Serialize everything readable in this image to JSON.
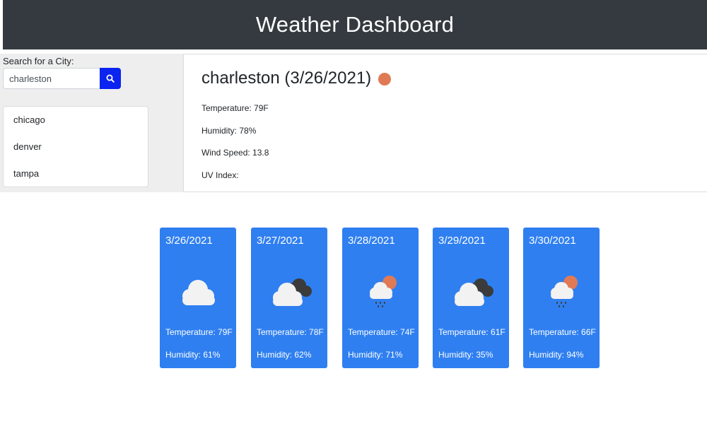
{
  "header": {
    "title": "Weather Dashboard"
  },
  "search": {
    "label": "Search for a City:",
    "value": "charleston",
    "button_icon": "search-icon"
  },
  "history": {
    "items": [
      "chicago",
      "denver",
      "tampa"
    ]
  },
  "current": {
    "city_date": "charleston (3/26/2021)",
    "icon": "sun-icon",
    "temperature": "Temperature: 79F",
    "humidity": "Humidity: 78%",
    "wind": "Wind Speed: 13.8",
    "uv": "UV Index:"
  },
  "forecast": [
    {
      "date": "3/26/2021",
      "icon": "cloud-icon",
      "temperature": "Temperature: 79F",
      "humidity": "Humidity: 61%"
    },
    {
      "date": "3/27/2021",
      "icon": "dark-clouds-icon",
      "temperature": "Temperature: 78F",
      "humidity": "Humidity: 62%"
    },
    {
      "date": "3/28/2021",
      "icon": "rain-sun-icon",
      "temperature": "Temperature: 74F",
      "humidity": "Humidity: 71%"
    },
    {
      "date": "3/29/2021",
      "icon": "dark-clouds-icon",
      "temperature": "Temperature: 61F",
      "humidity": "Humidity: 35%"
    },
    {
      "date": "3/30/2021",
      "icon": "rain-sun-icon",
      "temperature": "Temperature: 66F",
      "humidity": "Humidity: 94%"
    }
  ],
  "colors": {
    "header_bg": "#343a40",
    "card_bg": "#2f7ff0",
    "search_button": "#0b24f0",
    "sun": "#e07a55"
  }
}
